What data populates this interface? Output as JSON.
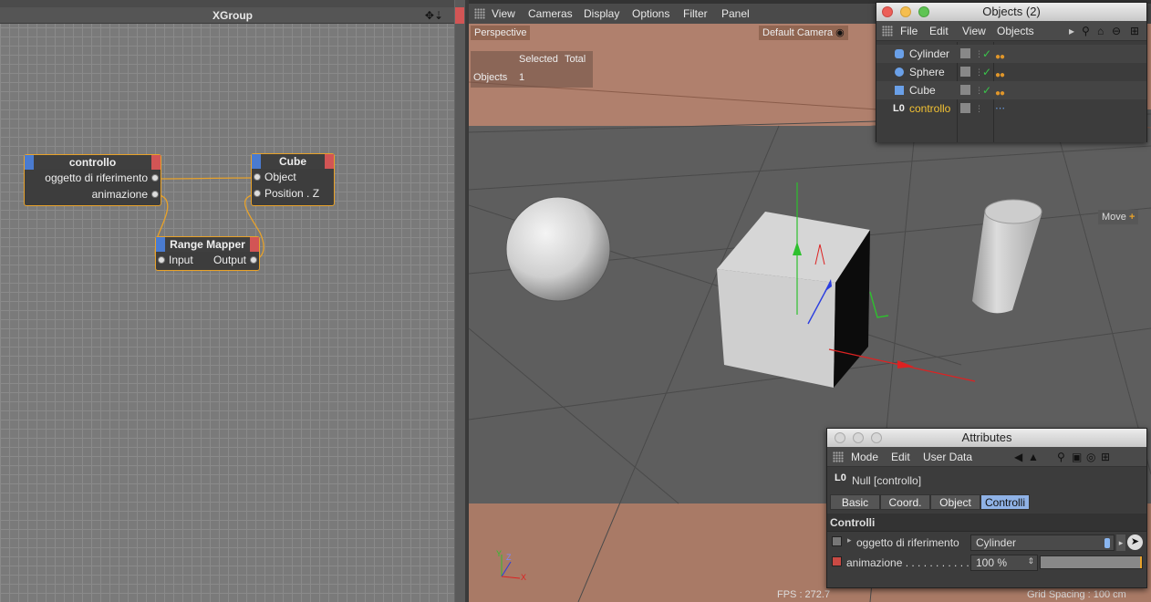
{
  "xpresso": {
    "title": "XGroup",
    "title_icons": "✥⇣",
    "nodes": {
      "controllo": {
        "title": "controllo",
        "ports": [
          "oggetto di riferimento",
          "animazione"
        ]
      },
      "cube": {
        "title": "Cube",
        "ports": [
          "Object",
          "Position . Z"
        ]
      },
      "range_mapper": {
        "title": "Range Mapper",
        "input": "Input",
        "output": "Output"
      }
    },
    "colors": {
      "wire": "#e8a22a",
      "node_border": "#e8a22a",
      "input_port": "#4a7bd0",
      "output_port": "#d25555"
    }
  },
  "viewport": {
    "menu": [
      "View",
      "Cameras",
      "Display",
      "Options",
      "Filter",
      "Panel"
    ],
    "camera_label": "Perspective",
    "default_camera": "Default Camera",
    "hud": {
      "col_selected": "Selected",
      "col_total": "Total",
      "row_label": "Objects",
      "selected_value": "1"
    },
    "move_label": "Move",
    "fps": "FPS : 272.7",
    "grid_spacing": "Grid Spacing : 100 cm",
    "axis": {
      "y": "Y",
      "z": "Z",
      "x": "X"
    }
  },
  "objects_window": {
    "title": "Objects (2)",
    "menu": [
      "File",
      "Edit",
      "View",
      "Objects"
    ],
    "items": [
      {
        "name": "Cylinder",
        "icon": "cylinder-icon",
        "visible_check": "✓"
      },
      {
        "name": "Sphere",
        "icon": "sphere-icon",
        "visible_check": "✓"
      },
      {
        "name": "Cube",
        "icon": "cube-icon",
        "visible_check": "✓"
      },
      {
        "name": "controllo",
        "icon": "null-icon",
        "selected": true
      }
    ],
    "selected_color": "#f3c233"
  },
  "attributes_window": {
    "title": "Attributes",
    "menu": [
      "Mode",
      "Edit",
      "User Data"
    ],
    "object_label": "Null [controllo]",
    "tabs": [
      "Basic",
      "Coord.",
      "Object",
      "Controlli"
    ],
    "active_tab": "Controlli",
    "section": "Controlli",
    "fields": {
      "oggetto": {
        "label": "oggetto di riferimento",
        "value": "Cylinder"
      },
      "animazione": {
        "label": "animazione . . . . . . . . . . .",
        "value": "100 %",
        "slider_fraction": 1.0
      }
    }
  }
}
